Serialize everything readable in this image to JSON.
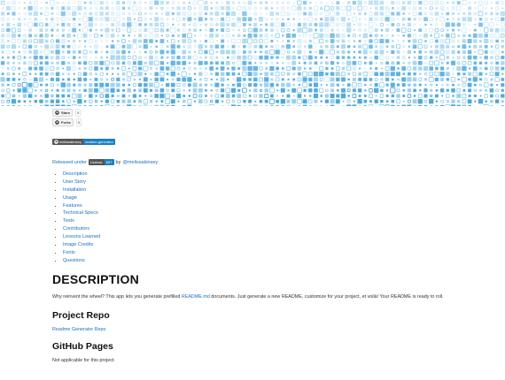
{
  "colors": {
    "hero_light": "#cfe9f7",
    "hero_mid": "#8fcbec",
    "hero_dark": "#3aa0dd",
    "link": "#1a6fc4",
    "badge_right": "#1a7fc1",
    "badge_left": "#555555"
  },
  "github_buttons": [
    {
      "label": "Stars",
      "count": "0",
      "icon": "github-icon"
    },
    {
      "label": "Forks",
      "count": "0",
      "icon": "github-icon"
    }
  ],
  "repo_badge": {
    "left": "melissakinsey",
    "right": "readme-generator"
  },
  "released": {
    "prefix": "Released under",
    "license_left": "License",
    "license_right": "MIT",
    "by": "by",
    "author": "@melissakinsey."
  },
  "toc": [
    "Description",
    "User Story",
    "Installation",
    "Usage",
    "Features",
    "Technical Specs",
    "Tests",
    "Contributors",
    "Lessons Learned",
    "Image Credits",
    "Fonts",
    "Questions"
  ],
  "description": {
    "heading": "DESCRIPTION",
    "text_before": "Why reinvent the wheel? This app lets you generate prefilled ",
    "link": "README.md",
    "text_after": " documents. Just generate a new README, customize for your project, et voilà! Your README is ready to roll."
  },
  "project_repo": {
    "heading": "Project Repo",
    "link": "Readme Generator Repo"
  },
  "github_pages": {
    "heading": "GitHub Pages",
    "text": "Not applicable for this project."
  }
}
